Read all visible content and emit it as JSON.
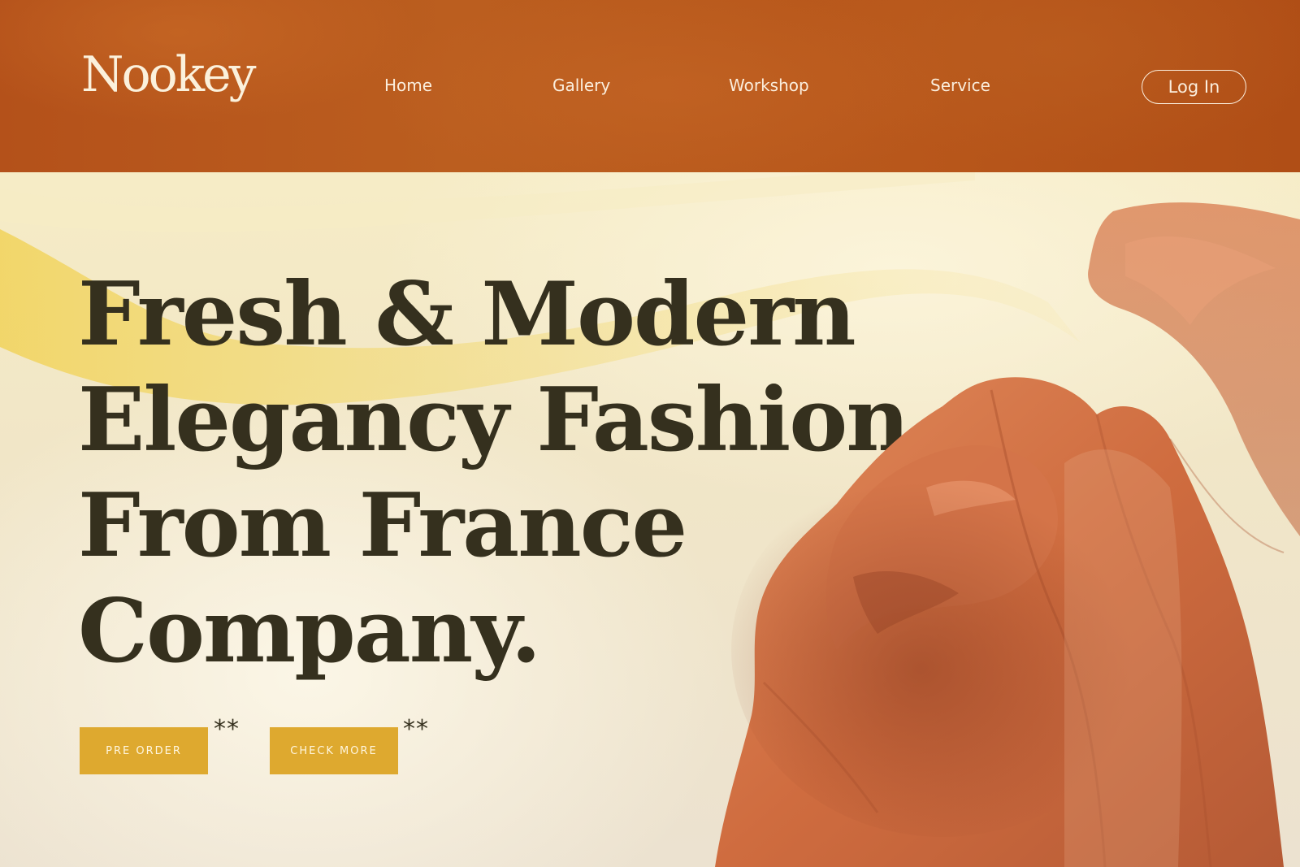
{
  "brand": {
    "logo_text": "Nookey"
  },
  "nav": {
    "items": [
      {
        "label": "Home"
      },
      {
        "label": "Gallery"
      },
      {
        "label": "Workshop"
      },
      {
        "label": "Service"
      }
    ],
    "login_label": "Log In"
  },
  "hero": {
    "headline_lines": [
      "Fresh & Modern",
      "Elegancy Fashion",
      "From France",
      "Company."
    ],
    "buttons": [
      {
        "label": "PRE ORDER",
        "mark": "**"
      },
      {
        "label": "CHECK MORE",
        "mark": "**"
      }
    ],
    "image": {
      "icon": "fabric-veiled-figure-image"
    }
  },
  "colors": {
    "header_bg": "#b8571b",
    "header_text": "#fbeedd",
    "hero_bg": "#f3ead3",
    "headline_text": "#35301e",
    "button_bg": "#dea92f",
    "button_text": "#fff6df",
    "fabric": "#cc6a3c"
  }
}
